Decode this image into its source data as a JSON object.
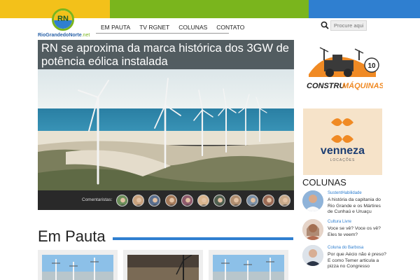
{
  "site": {
    "logo_badge": "RN",
    "logo_name": "RioGrandedoNorte",
    "logo_tld": ".net"
  },
  "nav": {
    "items": [
      "EM PAUTA",
      "TV RGNET",
      "COLUNAS",
      "CONTATO"
    ]
  },
  "search": {
    "placeholder": "Procure aqui",
    "icon": "magnifier"
  },
  "feature": {
    "title": "RN se aproxima da marca histórica dos 3GW de potência eólica instalada",
    "comment_label": "Comentaristas:",
    "commenter_count": 11
  },
  "ads": {
    "constru_name_a": "CONSTRU",
    "constru_name_b": "MÁQUINAS",
    "constru_badge": "10",
    "venneza_name": "venneza",
    "venneza_sub": "LOCAÇÕES"
  },
  "colunas": {
    "heading": "COLUNAS",
    "items": [
      {
        "category": "SustentHabilidade",
        "text": "A história da capitania do Rio Grande e os Mártires de Cunhaú e Uruaçu"
      },
      {
        "category": "Cultura Livre",
        "text": "Voce se vê? Voce os vê? Eles te veem?"
      },
      {
        "category": "Coluna do Barbosa",
        "text": "Por que Aécio não é preso? E como Temer articula a pizza no Congresso"
      }
    ]
  },
  "em_pauta": {
    "heading": "Em Pauta"
  },
  "colors": {
    "yellow": "#f3c11a",
    "green": "#7ab51d",
    "blue": "#2f7fd0"
  }
}
